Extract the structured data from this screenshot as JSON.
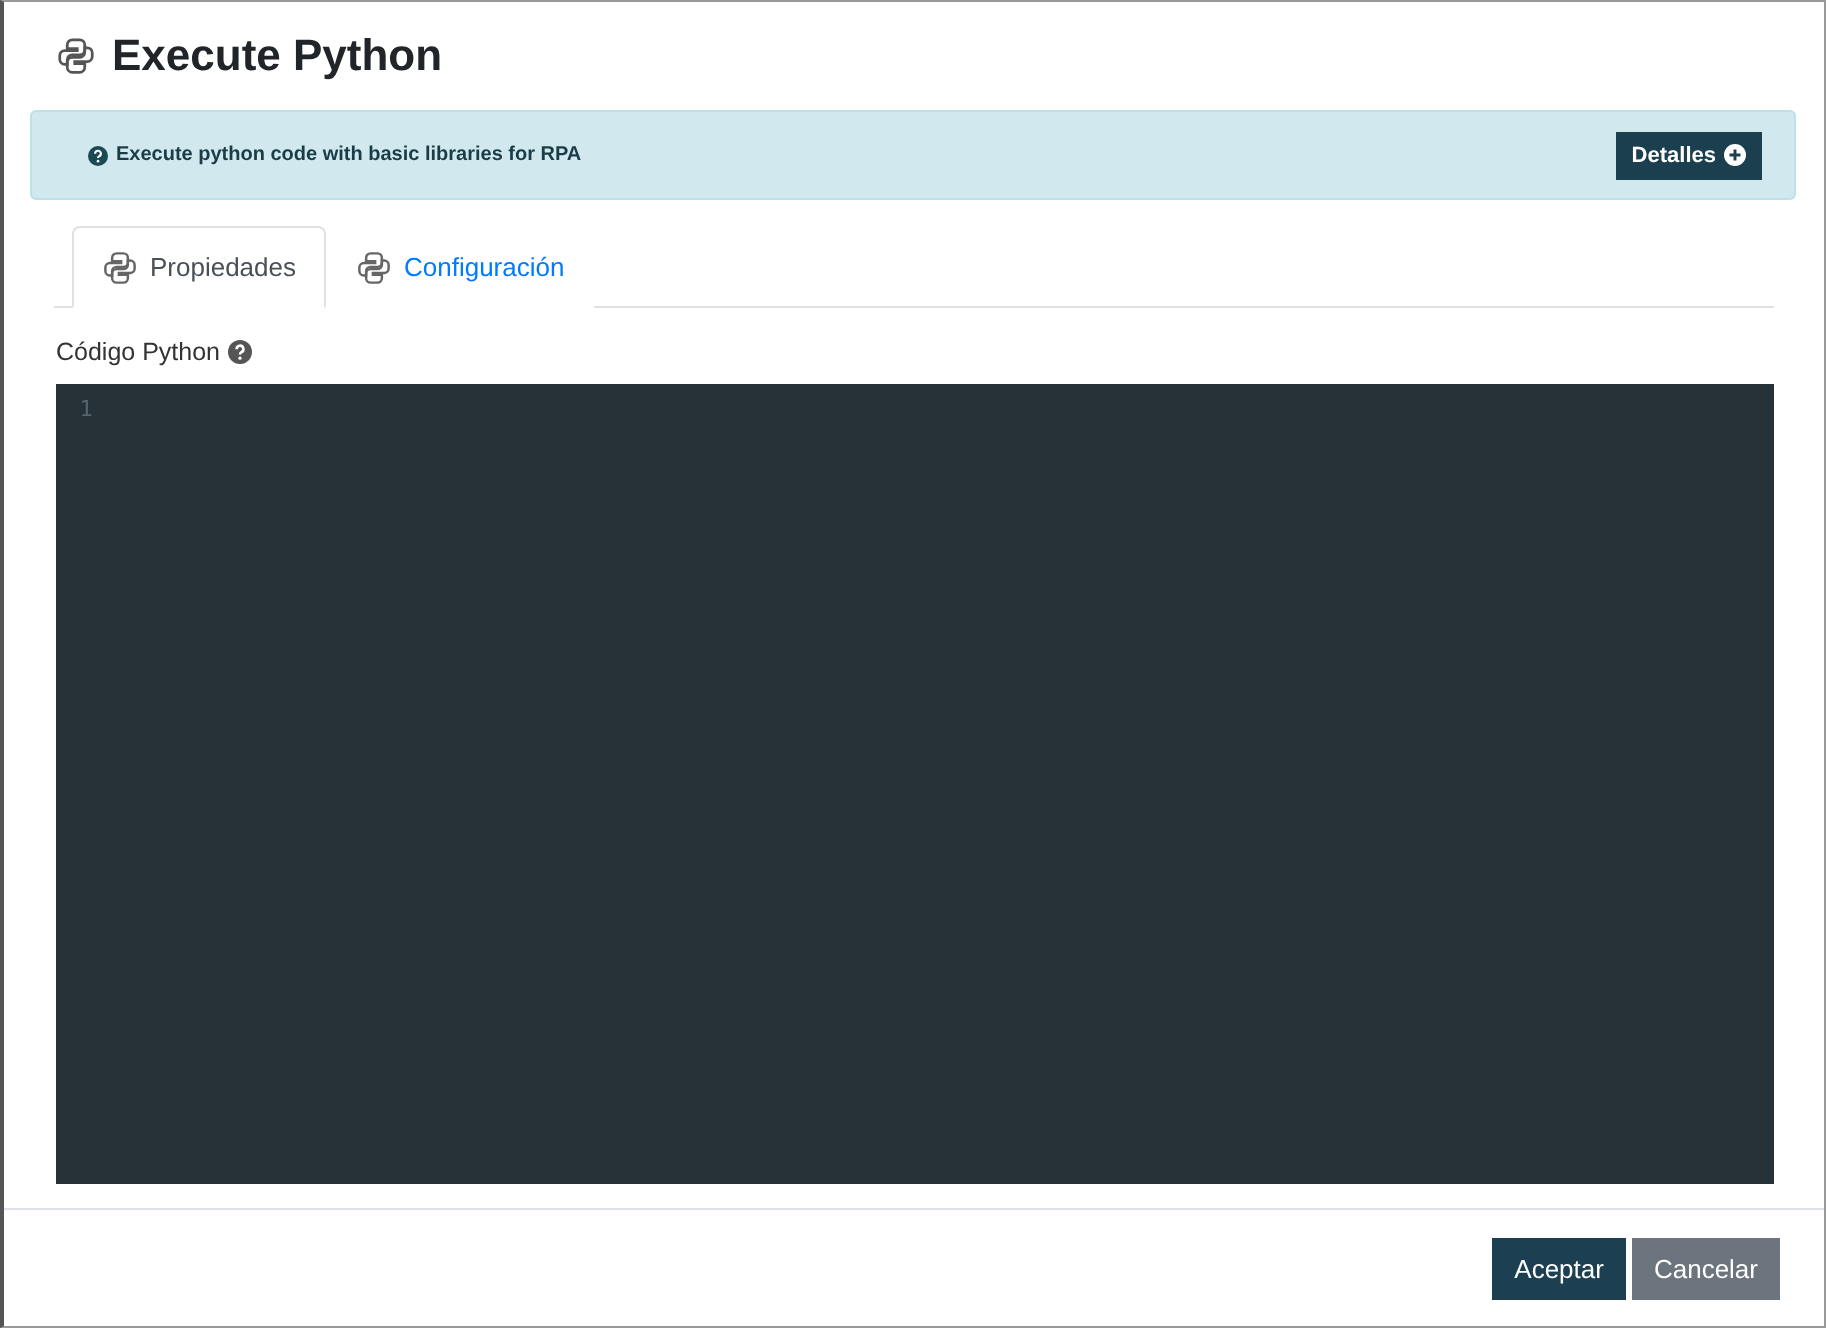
{
  "dialog": {
    "title": "Execute Python"
  },
  "info": {
    "text": "Execute python code with basic libraries for RPA",
    "button": "Detalles"
  },
  "tabs": [
    {
      "label": "Propiedades",
      "selected": true
    },
    {
      "label": "Configuración",
      "selected": false
    }
  ],
  "field": {
    "label": "Código Python"
  },
  "editor": {
    "line_numbers": [
      "1"
    ]
  },
  "buttons": [
    {
      "label": "Aceptar",
      "kind": "primary"
    },
    {
      "label": "Cancelar",
      "kind": "secondary"
    }
  ]
}
